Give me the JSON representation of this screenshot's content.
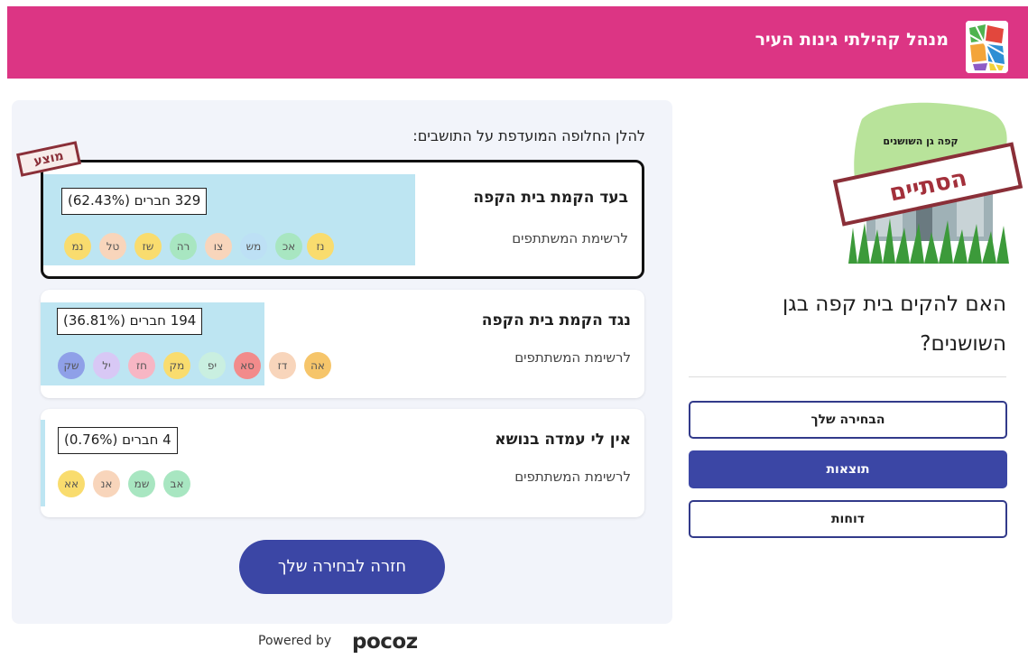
{
  "header": {
    "title": "מנהל קהילתי גינות העיר"
  },
  "poll": {
    "image_caption": "קפה גן השושנים",
    "stamp": "הסתיים",
    "question": "האם להקים בית קפה בגן השושנים?"
  },
  "nav": {
    "your_choice": "הבחירה שלך",
    "results": "תוצאות",
    "reports": "דוחות"
  },
  "results": {
    "heading": "להלן החלופה המועדפת על התושבים:",
    "recommended_badge": "מוצע",
    "options": [
      {
        "title": "בעד הקמת בית הקפה",
        "count_label": "329 חברים (62.43%)",
        "percent": 62.43,
        "link": "לרשימת המשתתפים",
        "avatars": [
          "נז",
          "אכ",
          "מש",
          "צו",
          "רה",
          "שז",
          "טל",
          "נמ"
        ],
        "avatar_colors": [
          "#f9dc6e",
          "#a8e6c1",
          "#bde0f5",
          "#f8d5bb",
          "#a8e6c1",
          "#f9dc6e",
          "#f8d5bb",
          "#f9dc6e"
        ]
      },
      {
        "title": "נגד הקמת בית הקפה",
        "count_label": "194 חברים (36.81%)",
        "percent": 36.81,
        "link": "לרשימת המשתתפים",
        "avatars": [
          "אה",
          "דז",
          "סא",
          "יפ",
          "מק",
          "חז",
          "יל",
          "שק"
        ],
        "avatar_colors": [
          "#f6c56a",
          "#f8d5bb",
          "#f28b8b",
          "#c9efe0",
          "#f9dc6e",
          "#f7b6c4",
          "#d8c8f5",
          "#8fa0e8"
        ]
      },
      {
        "title": "אין לי עמדה בנושא",
        "count_label": "4 חברים (0.76%)",
        "percent": 0.76,
        "link": "לרשימת המשתתפים",
        "avatars": [
          "אב",
          "שמ",
          "אנ",
          "אא"
        ],
        "avatar_colors": [
          "#a8e6c1",
          "#a8e6c1",
          "#f8d5bb",
          "#f9dc6e"
        ]
      }
    ],
    "back_button": "חזרה לבחירה שלך"
  },
  "footer": {
    "powered_by": "Powered by",
    "brand": "pocoz"
  },
  "colors": {
    "header_bg": "#dc3584",
    "primary": "#3b46a5",
    "bar": "#bde5f2"
  }
}
